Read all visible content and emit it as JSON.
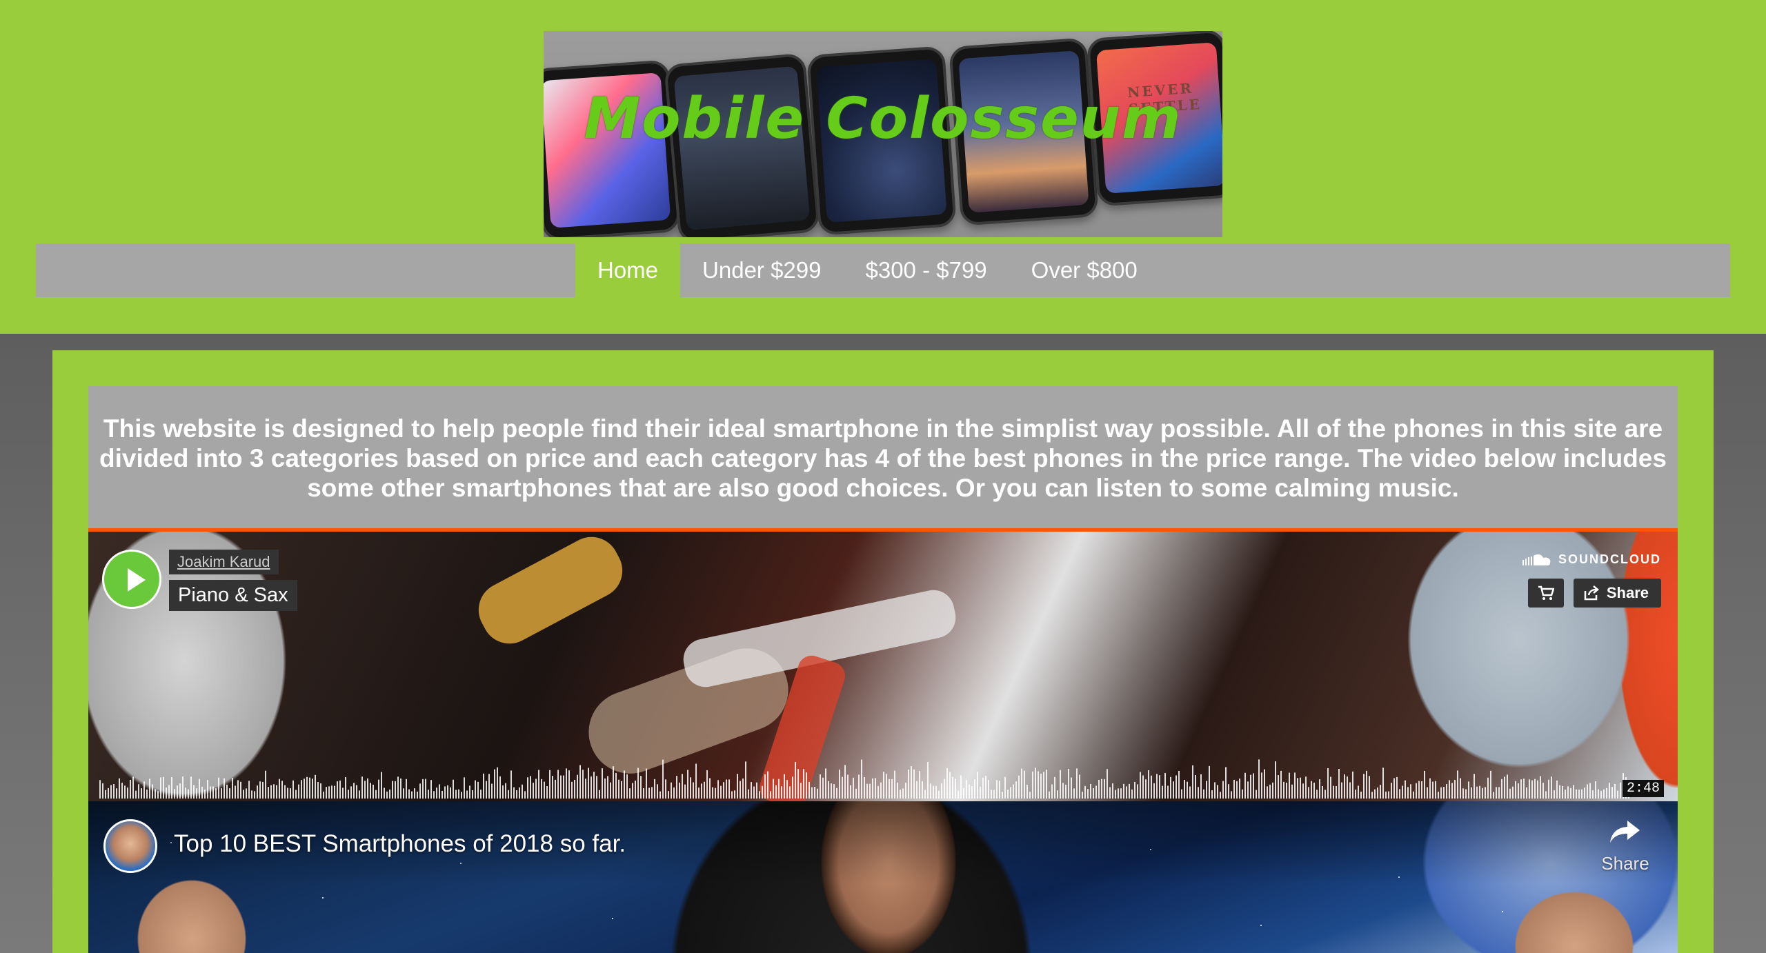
{
  "header": {
    "banner_title": "Mobile Colosseum",
    "phone_screen_text": "NEVER SETTLE"
  },
  "nav": {
    "items": [
      {
        "label": "Home",
        "active": true
      },
      {
        "label": "Under $299",
        "active": false
      },
      {
        "label": "$300 - $799",
        "active": false
      },
      {
        "label": "Over $800",
        "active": false
      }
    ]
  },
  "intro": {
    "text": "This website is designed to help people find their ideal smartphone in the simplist way possible. All of the phones in this site are divided into 3 categories based on price and each category has 4 of the best phones in the price range. The video below includes some other smartphones that are also good choices. Or you can listen to some calming music."
  },
  "soundcloud": {
    "artist": "Joakim Karud",
    "track": "Piano & Sax",
    "logo_text": "SOUNDCLOUD",
    "share_label": "Share",
    "duration": "2:48",
    "icons": {
      "play": "play-icon",
      "cart": "cart-icon",
      "share": "share-icon",
      "logo": "soundcloud-logo-icon"
    }
  },
  "youtube": {
    "title": "Top 10 BEST Smartphones of 2018 so far.",
    "share_label": "Share",
    "icons": {
      "share": "share-arrow-icon",
      "avatar": "channel-avatar"
    }
  },
  "colors": {
    "page_green": "#9acd3c",
    "nav_gray": "#a6a6a6",
    "soundcloud_orange": "#ff5500",
    "play_green": "#6ac93a"
  }
}
